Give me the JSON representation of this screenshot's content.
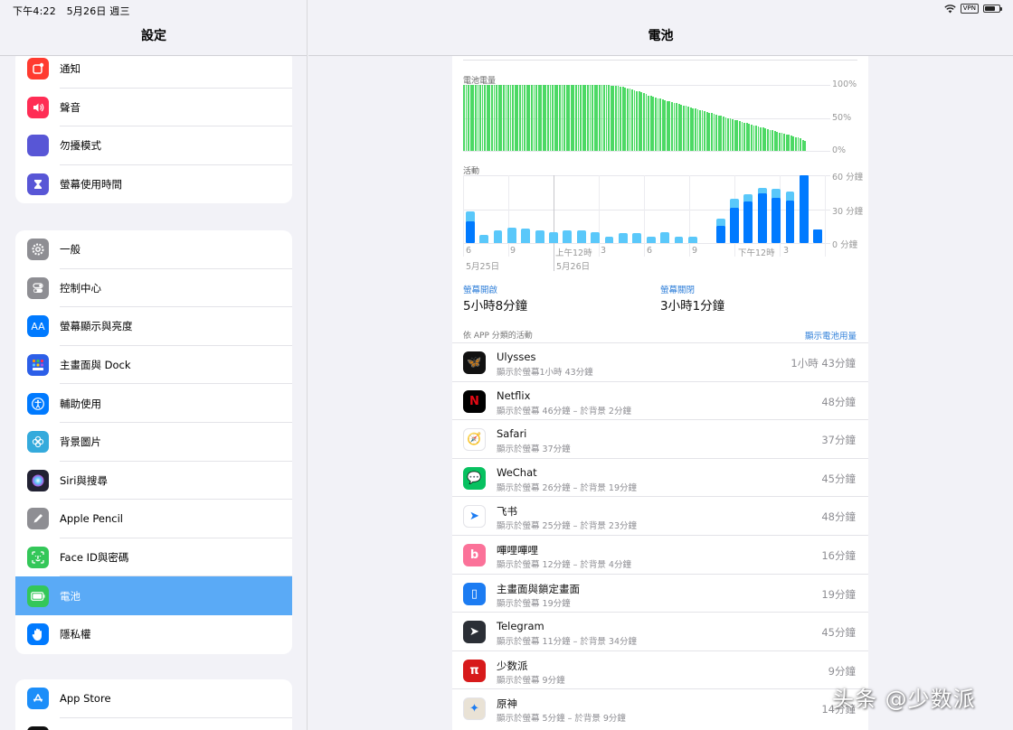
{
  "status": {
    "time": "下午4:22",
    "date": "5月26日 週三",
    "vpn": "VPN",
    "battery_fraction": 0.72
  },
  "sidebar": {
    "title": "設定",
    "groups": [
      [
        {
          "label": "通知",
          "icon": "notification-icon",
          "color": "#ff3b30"
        },
        {
          "label": "聲音",
          "icon": "sound-icon",
          "color": "#ff2d55"
        },
        {
          "label": "勿擾模式",
          "icon": "moon-icon",
          "color": "#5856d6"
        },
        {
          "label": "螢幕使用時間",
          "icon": "hourglass-icon",
          "color": "#5856d6"
        }
      ],
      [
        {
          "label": "一般",
          "icon": "gear-icon",
          "color": "#8e8e93"
        },
        {
          "label": "控制中心",
          "icon": "toggles-icon",
          "color": "#8e8e93"
        },
        {
          "label": "螢幕顯示與亮度",
          "icon": "display-icon",
          "color": "#007aff"
        },
        {
          "label": "主畫面與 Dock",
          "icon": "home-grid-icon",
          "color": "#2c5fe8"
        },
        {
          "label": "輔助使用",
          "icon": "accessibility-icon",
          "color": "#007aff"
        },
        {
          "label": "背景圖片",
          "icon": "wallpaper-icon",
          "color": "#34aadc"
        },
        {
          "label": "Siri與搜尋",
          "icon": "siri-icon",
          "color": "#222233"
        },
        {
          "label": "Apple Pencil",
          "icon": "pencil-icon",
          "color": "#8e8e93"
        },
        {
          "label": "Face ID與密碼",
          "icon": "faceid-icon",
          "color": "#34c759"
        },
        {
          "label": "電池",
          "icon": "battery-icon",
          "color": "#34c759",
          "selected": true
        },
        {
          "label": "隱私權",
          "icon": "hand-icon",
          "color": "#007aff"
        }
      ],
      [
        {
          "label": "App Store",
          "icon": "appstore-icon",
          "color": "#1c8ef9"
        },
        {
          "label": "",
          "icon": "wallet-icon",
          "color": "#111111"
        }
      ]
    ]
  },
  "main": {
    "title": "電池",
    "battery_chart_label": "電池電量",
    "activity_chart_label": "活動",
    "screen_on_label": "螢幕開啟",
    "screen_on_value": "5小時8分鐘",
    "screen_off_label": "螢幕關閉",
    "screen_off_value": "3小時1分鐘",
    "by_app_label": "依 APP 分類的活動",
    "show_usage_link": "顯示電池用量",
    "apps": [
      {
        "name": "Ulysses",
        "detail": "顯示於螢幕1小時 43分鐘",
        "time": "1小時 43分鐘",
        "icon": "ulysses-icon",
        "color": "#111111",
        "glyph": "🦋"
      },
      {
        "name": "Netflix",
        "detail": "顯示於螢幕 46分鐘 – 於背景 2分鐘",
        "time": "48分鐘",
        "icon": "netflix-icon",
        "color": "#000000",
        "glyph": "N"
      },
      {
        "name": "Safari",
        "detail": "顯示於螢幕 37分鐘",
        "time": "37分鐘",
        "icon": "safari-icon",
        "color": "#ffffff",
        "glyph": "🧭"
      },
      {
        "name": "WeChat",
        "detail": "顯示於螢幕 26分鐘 – 於背景 19分鐘",
        "time": "45分鐘",
        "icon": "wechat-icon",
        "color": "#07c160",
        "glyph": "💬"
      },
      {
        "name": "飞书",
        "detail": "顯示於螢幕 25分鐘 – 於背景 23分鐘",
        "time": "48分鐘",
        "icon": "feishu-icon",
        "color": "#ffffff",
        "glyph": "➤"
      },
      {
        "name": "嗶哩嗶哩",
        "detail": "顯示於螢幕 12分鐘 – 於背景 4分鐘",
        "time": "16分鐘",
        "icon": "bilibili-icon",
        "color": "#fb7299",
        "glyph": "b"
      },
      {
        "name": "主畫面與鎖定畫面",
        "detail": "顯示於螢幕 19分鐘",
        "time": "19分鐘",
        "icon": "homescreen-icon",
        "color": "#1c7cf2",
        "glyph": "▯"
      },
      {
        "name": "Telegram",
        "detail": "顯示於螢幕 11分鐘 – 於背景 34分鐘",
        "time": "45分鐘",
        "icon": "telegram-icon",
        "color": "#2b2f36",
        "glyph": "➤"
      },
      {
        "name": "少数派",
        "detail": "顯示於螢幕 9分鐘",
        "time": "9分鐘",
        "icon": "sspai-icon",
        "color": "#d71a1b",
        "glyph": "π"
      },
      {
        "name": "原神",
        "detail": "顯示於螢幕 5分鐘 – 於背景 9分鐘",
        "time": "14分鐘",
        "icon": "genshin-icon",
        "color": "#e9e2d5",
        "glyph": "✦"
      }
    ]
  },
  "chart_data": [
    {
      "type": "bar",
      "title": "電池電量",
      "ylim": [
        0,
        100
      ],
      "y_ticks": [
        "100%",
        "50%",
        "0%"
      ],
      "values": [
        100,
        100,
        100,
        100,
        100,
        100,
        100,
        100,
        100,
        100,
        100,
        100,
        100,
        100,
        100,
        100,
        100,
        100,
        100,
        100,
        100,
        100,
        100,
        100,
        100,
        100,
        100,
        100,
        100,
        100,
        100,
        100,
        100,
        100,
        100,
        100,
        100,
        100,
        100,
        100,
        100,
        100,
        100,
        100,
        100,
        100,
        100,
        100,
        100,
        100,
        100,
        100,
        100,
        100,
        100,
        100,
        100,
        100,
        100,
        100,
        100,
        100,
        100,
        99,
        99,
        98,
        98,
        97,
        97,
        96,
        95,
        94,
        93,
        92,
        91,
        90,
        89,
        87,
        86,
        84,
        83,
        82,
        81,
        80,
        79,
        78,
        77,
        76,
        75,
        74,
        73,
        72,
        71,
        70,
        69,
        68,
        67,
        66,
        65,
        64,
        63,
        62,
        61,
        60,
        59,
        58,
        57,
        56,
        55,
        54,
        53,
        52,
        51,
        50,
        49,
        48,
        47,
        46,
        45,
        44,
        43,
        42,
        41,
        40,
        39,
        38,
        37,
        36,
        35,
        34,
        33,
        32,
        31,
        30,
        29,
        28,
        27,
        26,
        25,
        24,
        23,
        22,
        21,
        20,
        19,
        17,
        15
      ],
      "color": "#4cd964"
    },
    {
      "type": "bar",
      "title": "活動",
      "ylim": [
        0,
        60
      ],
      "y_ticks": [
        "60 分鐘",
        "30 分鐘",
        "0 分鐘"
      ],
      "x_ticks": [
        "6",
        "9",
        "上午12時",
        "3",
        "6",
        "9",
        "下午12時",
        "3"
      ],
      "date_labels": [
        "5月25日",
        "5月26日"
      ],
      "series": [
        {
          "name": "螢幕開啟",
          "values": [
            19,
            0,
            0,
            0,
            0,
            0,
            0,
            0,
            0,
            0,
            0,
            0,
            0,
            0,
            0,
            0,
            0,
            0,
            15,
            31,
            37,
            44,
            40,
            38,
            60,
            12
          ],
          "color": "#007aff"
        },
        {
          "name": "螢幕關閉",
          "values": [
            9,
            7,
            11,
            14,
            13,
            11,
            10,
            11,
            11,
            10,
            6,
            9,
            9,
            6,
            10,
            6,
            6,
            0,
            7,
            8,
            6,
            5,
            8,
            8,
            0,
            0
          ],
          "color": "#5ac8fa"
        }
      ]
    }
  ]
}
